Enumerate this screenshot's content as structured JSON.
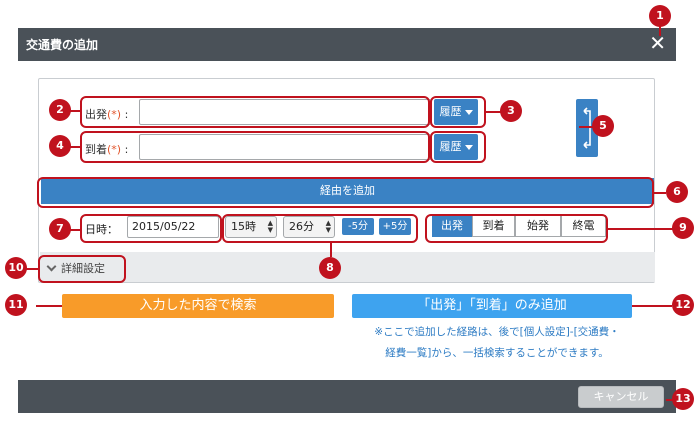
{
  "dialog": {
    "title": "交通費の追加",
    "close_glyph": "✕",
    "cancel_label": "キャンセル"
  },
  "departure": {
    "label": "出発",
    "required_mark": "(*)",
    "colon": ":",
    "value": "",
    "history_label": "履歴"
  },
  "arrival": {
    "label": "到着",
    "required_mark": "(*)",
    "colon": ":",
    "value": "",
    "history_label": "履歴"
  },
  "via_label": "経由を追加",
  "datetime": {
    "label": "日時：",
    "date": "2015/05/22",
    "hour": "15時",
    "minute": "26分",
    "minus5": "-5分",
    "plus5": "+5分"
  },
  "time_mode": {
    "options": [
      "出発",
      "到着",
      "始発",
      "終電"
    ],
    "selected": "出発"
  },
  "detail_settings_label": "詳細設定",
  "search_button_label": "入力した内容で検索",
  "add_only_button_label": "「出発」「到着」のみ追加",
  "note_lines": [
    "※ここで追加した経路は、後で[個人設定]-[交通費・",
    "経費一覧]から、一括検索することができます。"
  ],
  "callouts": [
    "1",
    "2",
    "3",
    "4",
    "5",
    "6",
    "7",
    "8",
    "9",
    "10",
    "11",
    "12",
    "13"
  ],
  "colors": {
    "titlebar": "#4a5158",
    "primary": "#3a82c4",
    "orange": "#f89b29",
    "light_blue": "#3ea3ef",
    "annotation": "#c0121e"
  },
  "icons": {
    "close": "close-icon",
    "dropdown": "caret-down-icon",
    "swap": "swap-icon",
    "expand": "chevron-down-icon"
  }
}
